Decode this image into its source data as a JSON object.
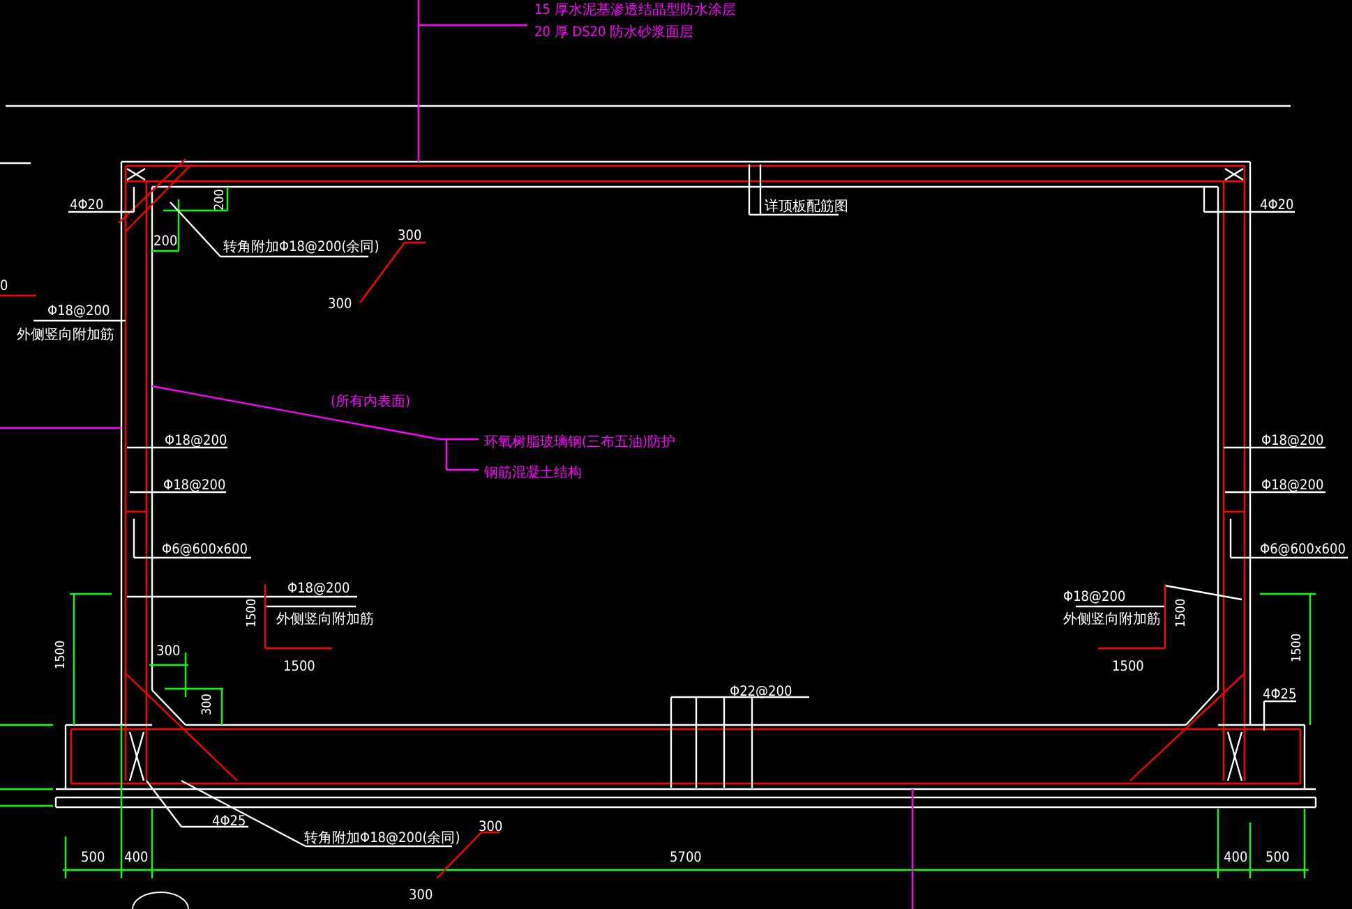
{
  "labels": [
    {
      "text": "15 厚水泥基渗透结晶型防水涂层",
      "kind": "note"
    },
    {
      "text": "20 厚 DS20 防水砂浆面层",
      "kind": "note"
    },
    {
      "text": "4Φ20",
      "kind": "label"
    },
    {
      "text": "200",
      "kind": "dimension_vertical"
    },
    {
      "text": "详顶板配筋图",
      "kind": "label"
    },
    {
      "text": "4Φ20",
      "kind": "label"
    },
    {
      "text": "200",
      "kind": "label"
    },
    {
      "text": "转角附加Φ18@200(余同)",
      "kind": "label"
    },
    {
      "text": "300",
      "kind": "label"
    },
    {
      "text": "0",
      "kind": "label"
    },
    {
      "text": "300",
      "kind": "label"
    },
    {
      "text": "Φ18@200",
      "kind": "label"
    },
    {
      "text": "外侧竖向附加筋",
      "kind": "label"
    },
    {
      "text": "(所有内表面)",
      "kind": "note"
    },
    {
      "text": "Φ18@200",
      "kind": "label"
    },
    {
      "text": "环氧树脂玻璃钢(三布五油)防护",
      "kind": "note"
    },
    {
      "text": "Φ18@200",
      "kind": "label"
    },
    {
      "text": "钢筋混凝土结构",
      "kind": "note"
    },
    {
      "text": "Φ18@200",
      "kind": "label"
    },
    {
      "text": "Φ18@200",
      "kind": "label"
    },
    {
      "text": "Φ6@600x600",
      "kind": "label"
    },
    {
      "text": "Φ6@600x600",
      "kind": "label"
    },
    {
      "text": "Φ18@200",
      "kind": "label"
    },
    {
      "text": "Φ18@200",
      "kind": "label"
    },
    {
      "text": "外侧竖向附加筋",
      "kind": "label"
    },
    {
      "text": "外侧竖向附加筋",
      "kind": "label"
    },
    {
      "text": "1500",
      "kind": "dimension_vertical"
    },
    {
      "text": "1500",
      "kind": "dimension_vertical"
    },
    {
      "text": "1500",
      "kind": "dimension_vertical"
    },
    {
      "text": "1500",
      "kind": "dimension_vertical"
    },
    {
      "text": "300",
      "kind": "label"
    },
    {
      "text": "1500",
      "kind": "label"
    },
    {
      "text": "1500",
      "kind": "label"
    },
    {
      "text": "Φ22@200",
      "kind": "label"
    },
    {
      "text": "4Φ25",
      "kind": "label"
    },
    {
      "text": "300",
      "kind": "dimension_vertical"
    },
    {
      "text": "4Φ25",
      "kind": "label"
    },
    {
      "text": "转角附加Φ18@200(余同)",
      "kind": "label"
    },
    {
      "text": "300",
      "kind": "label"
    },
    {
      "text": "500",
      "kind": "label"
    },
    {
      "text": "400",
      "kind": "label"
    },
    {
      "text": "5700",
      "kind": "label"
    },
    {
      "text": "400",
      "kind": "label"
    },
    {
      "text": "500",
      "kind": "label"
    },
    {
      "text": "300",
      "kind": "label"
    }
  ]
}
